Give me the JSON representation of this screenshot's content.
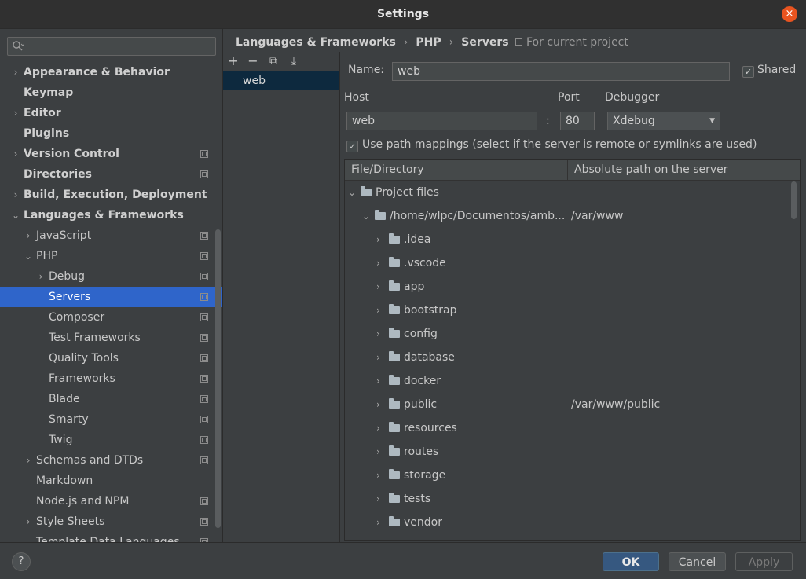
{
  "window": {
    "title": "Settings",
    "close_glyph": "×"
  },
  "search": {
    "value": "",
    "icon": "search-icon"
  },
  "tree": [
    {
      "label": "Appearance & Behavior",
      "arrow": "›",
      "bold": true,
      "proj": false
    },
    {
      "label": "Keymap",
      "arrow": "",
      "bold": true,
      "proj": false
    },
    {
      "label": "Editor",
      "arrow": "›",
      "bold": true,
      "proj": false
    },
    {
      "label": "Plugins",
      "arrow": "",
      "bold": true,
      "proj": false
    },
    {
      "label": "Version Control",
      "arrow": "›",
      "bold": true,
      "proj": true
    },
    {
      "label": "Directories",
      "arrow": "",
      "bold": true,
      "proj": true
    },
    {
      "label": "Build, Execution, Deployment",
      "arrow": "›",
      "bold": true,
      "proj": false
    },
    {
      "label": "Languages & Frameworks",
      "arrow": "⌄",
      "bold": true,
      "proj": false
    },
    {
      "label": "JavaScript",
      "arrow": "›",
      "bold": false,
      "proj": true
    },
    {
      "label": "PHP",
      "arrow": "⌄",
      "bold": false,
      "proj": true
    },
    {
      "label": "Debug",
      "arrow": "›",
      "bold": false,
      "proj": true
    },
    {
      "label": "Servers",
      "arrow": "",
      "bold": false,
      "proj": true,
      "selected": true
    },
    {
      "label": "Composer",
      "arrow": "",
      "bold": false,
      "proj": true
    },
    {
      "label": "Test Frameworks",
      "arrow": "",
      "bold": false,
      "proj": true
    },
    {
      "label": "Quality Tools",
      "arrow": "",
      "bold": false,
      "proj": true
    },
    {
      "label": "Frameworks",
      "arrow": "",
      "bold": false,
      "proj": true
    },
    {
      "label": "Blade",
      "arrow": "",
      "bold": false,
      "proj": true
    },
    {
      "label": "Smarty",
      "arrow": "",
      "bold": false,
      "proj": true
    },
    {
      "label": "Twig",
      "arrow": "",
      "bold": false,
      "proj": true
    },
    {
      "label": "Schemas and DTDs",
      "arrow": "›",
      "bold": false,
      "proj": true
    },
    {
      "label": "Markdown",
      "arrow": "",
      "bold": false,
      "proj": false
    },
    {
      "label": "Node.js and NPM",
      "arrow": "",
      "bold": false,
      "proj": true
    },
    {
      "label": "Style Sheets",
      "arrow": "›",
      "bold": false,
      "proj": true
    },
    {
      "label": "Template Data Languages",
      "arrow": "",
      "bold": false,
      "proj": true
    }
  ],
  "breadcrumb": {
    "items": [
      "Languages & Frameworks",
      "PHP",
      "Servers"
    ],
    "separator": "›",
    "scope": "For current project"
  },
  "toolbar": {
    "add": "+",
    "remove": "−",
    "copy": "⧉",
    "import": "⤓"
  },
  "servers": [
    "web"
  ],
  "form": {
    "name_label": "Name:",
    "name_value": "web",
    "shared_label": "Shared",
    "shared_checked": "✓",
    "host_label": "Host",
    "host_value": "web",
    "colon": ":",
    "port_label": "Port",
    "port_value": "80",
    "debugger_label": "Debugger",
    "debugger_value": "Xdebug",
    "debugger_arrow": "▼",
    "use_mappings_label": "Use path mappings (select if the server is remote or symlinks are used)",
    "use_mappings_checked": "✓"
  },
  "mapping": {
    "col1": "File/Directory",
    "col2": "Absolute path on the server",
    "rows": [
      {
        "name": "Project files",
        "remote": "",
        "arrow": "⌄",
        "level": 0
      },
      {
        "name": "/home/wlpc/Documentos/amb...",
        "remote": "/var/www",
        "arrow": "⌄",
        "level": 1
      },
      {
        "name": ".idea",
        "remote": "",
        "arrow": "›",
        "level": 2
      },
      {
        "name": ".vscode",
        "remote": "",
        "arrow": "›",
        "level": 2
      },
      {
        "name": "app",
        "remote": "",
        "arrow": "›",
        "level": 2
      },
      {
        "name": "bootstrap",
        "remote": "",
        "arrow": "›",
        "level": 2
      },
      {
        "name": "config",
        "remote": "",
        "arrow": "›",
        "level": 2
      },
      {
        "name": "database",
        "remote": "",
        "arrow": "›",
        "level": 2
      },
      {
        "name": "docker",
        "remote": "",
        "arrow": "›",
        "level": 2
      },
      {
        "name": "public",
        "remote": "/var/www/public",
        "arrow": "›",
        "level": 2
      },
      {
        "name": "resources",
        "remote": "",
        "arrow": "›",
        "level": 2
      },
      {
        "name": "routes",
        "remote": "",
        "arrow": "›",
        "level": 2
      },
      {
        "name": "storage",
        "remote": "",
        "arrow": "›",
        "level": 2
      },
      {
        "name": "tests",
        "remote": "",
        "arrow": "›",
        "level": 2
      },
      {
        "name": "vendor",
        "remote": "",
        "arrow": "›",
        "level": 2
      }
    ]
  },
  "footer": {
    "help": "?",
    "ok": "OK",
    "cancel": "Cancel",
    "apply": "Apply"
  },
  "colors": {
    "accent": "#2f65ca",
    "close": "#e95420",
    "ok": "#365880"
  }
}
